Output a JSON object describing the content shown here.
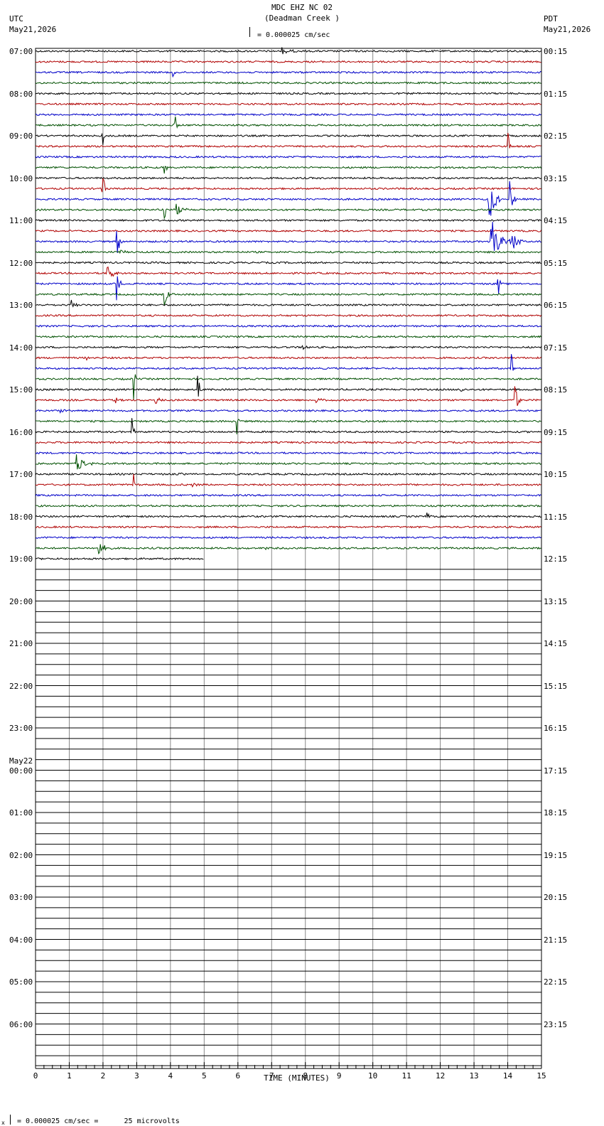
{
  "header": {
    "station_line": "MDC EHZ NC 02",
    "location_line": "(Deadman Creek )",
    "scale_text": "= 0.000025 cm/sec",
    "left_zone": "UTC",
    "left_date": "May21,2026",
    "right_zone": "PDT",
    "right_date": "May21,2026"
  },
  "footer": {
    "scale_text": "= 0.000025 cm/sec =      25 microvolts",
    "prefix_mark": "x"
  },
  "chart_data": {
    "type": "line",
    "title": "MDC EHZ NC 02 (Deadman Creek )",
    "xlabel": "TIME (MINUTES)",
    "ylabel": "",
    "x_range": [
      0,
      15
    ],
    "x_ticks": [
      "0",
      "1",
      "2",
      "3",
      "4",
      "5",
      "6",
      "7",
      "8",
      "9",
      "10",
      "11",
      "12",
      "13",
      "14",
      "15"
    ],
    "rows_per_hour": 4,
    "total_rows": 96,
    "recorded_rows": 49,
    "last_row_end_minute": 5,
    "trace_colors": [
      "#000000",
      "#b00000",
      "#0000c8",
      "#005000"
    ],
    "grid_color": "#888888",
    "utc_labels": [
      "07:00",
      "08:00",
      "09:00",
      "10:00",
      "11:00",
      "12:00",
      "13:00",
      "14:00",
      "15:00",
      "16:00",
      "17:00",
      "18:00",
      "19:00",
      "20:00",
      "21:00",
      "22:00",
      "23:00",
      "00:00",
      "01:00",
      "02:00",
      "03:00",
      "04:00",
      "05:00",
      "06:00"
    ],
    "date_change_label": "May22",
    "date_change_hour_index": 17,
    "pdt_labels": [
      "00:15",
      "01:15",
      "02:15",
      "03:15",
      "04:15",
      "05:15",
      "06:15",
      "07:15",
      "08:15",
      "09:15",
      "10:15",
      "11:15",
      "12:15",
      "13:15",
      "14:15",
      "15:15",
      "16:15",
      "17:15",
      "18:15",
      "19:15",
      "20:15",
      "21:15",
      "22:15",
      "23:15"
    ],
    "events": [
      {
        "row": 0,
        "minute": 7.3,
        "amp": 6,
        "dur": 0.5
      },
      {
        "row": 2,
        "minute": 4.05,
        "amp": 28,
        "dur": 0.1
      },
      {
        "row": 7,
        "minute": 4.1,
        "amp": 60,
        "dur": 0.1
      },
      {
        "row": 8,
        "minute": 1.95,
        "amp": 55,
        "dur": 0.1
      },
      {
        "row": 9,
        "minute": 14.0,
        "amp": 40,
        "dur": 0.1
      },
      {
        "row": 11,
        "minute": 3.8,
        "amp": 40,
        "dur": 0.1
      },
      {
        "row": 13,
        "minute": 1.95,
        "amp": 50,
        "dur": 0.15
      },
      {
        "row": 14,
        "minute": 13.4,
        "amp": 50,
        "dur": 0.4
      },
      {
        "row": 14,
        "minute": 14.05,
        "amp": 50,
        "dur": 0.2
      },
      {
        "row": 15,
        "minute": 3.8,
        "amp": 40,
        "dur": 0.1
      },
      {
        "row": 15,
        "minute": 4.15,
        "amp": 12,
        "dur": 0.4
      },
      {
        "row": 18,
        "minute": 2.4,
        "amp": 30,
        "dur": 0.2
      },
      {
        "row": 18,
        "minute": 13.5,
        "amp": 35,
        "dur": 0.6
      },
      {
        "row": 18,
        "minute": 14.1,
        "amp": 20,
        "dur": 0.4
      },
      {
        "row": 19,
        "minute": 2.5,
        "amp": 10,
        "dur": 0.2
      },
      {
        "row": 21,
        "minute": 2.1,
        "amp": 15,
        "dur": 0.4
      },
      {
        "row": 22,
        "minute": 2.4,
        "amp": 25,
        "dur": 0.2
      },
      {
        "row": 22,
        "minute": 13.7,
        "amp": 40,
        "dur": 0.1
      },
      {
        "row": 23,
        "minute": 3.8,
        "amp": 18,
        "dur": 0.3
      },
      {
        "row": 24,
        "minute": 1.05,
        "amp": 12,
        "dur": 0.2
      },
      {
        "row": 28,
        "minute": 7.9,
        "amp": 8,
        "dur": 0.15
      },
      {
        "row": 29,
        "minute": 1.5,
        "amp": 5,
        "dur": 0.2
      },
      {
        "row": 30,
        "minute": 14.1,
        "amp": 45,
        "dur": 0.1
      },
      {
        "row": 31,
        "minute": 2.9,
        "amp": 40,
        "dur": 0.1
      },
      {
        "row": 32,
        "minute": 4.8,
        "amp": 25,
        "dur": 0.2
      },
      {
        "row": 32,
        "minute": 12.6,
        "amp": 12,
        "dur": 0.1
      },
      {
        "row": 33,
        "minute": 2.35,
        "amp": 6,
        "dur": 0.2
      },
      {
        "row": 33,
        "minute": 3.5,
        "amp": 8,
        "dur": 0.4
      },
      {
        "row": 33,
        "minute": 8.3,
        "amp": 5,
        "dur": 0.4
      },
      {
        "row": 33,
        "minute": 14.2,
        "amp": 30,
        "dur": 0.2
      },
      {
        "row": 34,
        "minute": 0.7,
        "amp": 5,
        "dur": 0.3
      },
      {
        "row": 35,
        "minute": 5.95,
        "amp": 30,
        "dur": 0.1
      },
      {
        "row": 36,
        "minute": 2.85,
        "amp": 30,
        "dur": 0.1
      },
      {
        "row": 39,
        "minute": 1.2,
        "amp": 14,
        "dur": 0.6
      },
      {
        "row": 40,
        "minute": 4.2,
        "amp": 5,
        "dur": 0.2
      },
      {
        "row": 41,
        "minute": 2.9,
        "amp": 20,
        "dur": 0.1
      },
      {
        "row": 41,
        "minute": 4.65,
        "amp": 6,
        "dur": 0.2
      },
      {
        "row": 44,
        "minute": 11.6,
        "amp": 7,
        "dur": 0.2
      },
      {
        "row": 47,
        "minute": 1.85,
        "amp": 14,
        "dur": 0.4
      },
      {
        "row": 47,
        "minute": 6.7,
        "amp": 4,
        "dur": 0.3
      }
    ]
  }
}
